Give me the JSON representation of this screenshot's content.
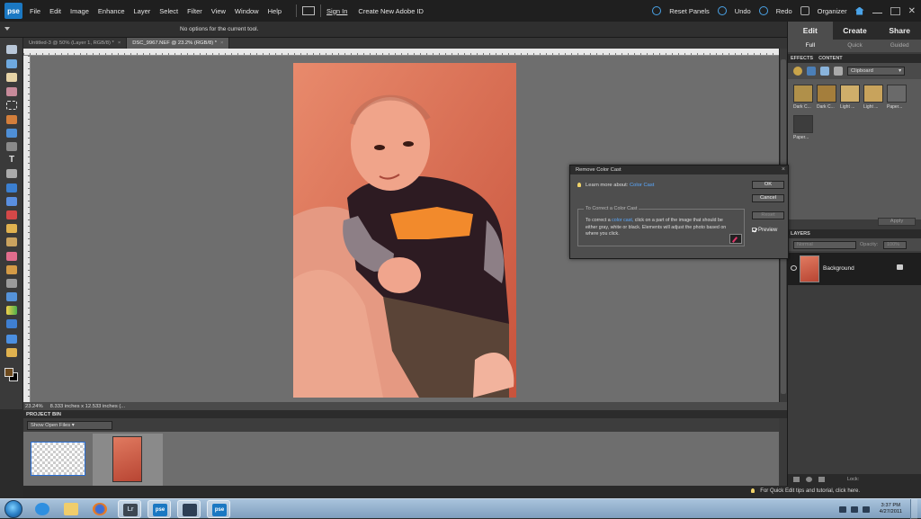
{
  "app": {
    "logo": "pse"
  },
  "menu": [
    "File",
    "Edit",
    "Image",
    "Enhance",
    "Layer",
    "Select",
    "Filter",
    "View",
    "Window",
    "Help"
  ],
  "topbar": {
    "sign_in": "Sign In",
    "create_id": "Create New Adobe ID",
    "reset_panels": "Reset Panels",
    "undo": "Undo",
    "redo": "Redo",
    "organizer": "Organizer"
  },
  "options_bar": {
    "text": "No options for the current tool."
  },
  "doc_tabs": [
    {
      "label": "Untitled-3 @ 50% (Layer 1, RGB/8) *",
      "active": false
    },
    {
      "label": "DSC_9967.NEF @ 23.2% (RGB/8) *",
      "active": true
    }
  ],
  "status": {
    "zoom": "23.24%",
    "info": "8.333 inches x 12.533 inches (..."
  },
  "project_bin": {
    "title": "PROJECT BIN",
    "dropdown": "Show Open Files"
  },
  "panel": {
    "mode_tabs": [
      "Edit",
      "Create",
      "Share"
    ],
    "sub_tabs": [
      "Full",
      "Quick",
      "Guided"
    ],
    "effects_tabs": [
      "EFFECTS",
      "CONTENT"
    ],
    "effects_dropdown": "Clipboard",
    "effects": [
      {
        "label": "Dark C...",
        "color": "#b0904a"
      },
      {
        "label": "Dark C...",
        "color": "#a47e3c"
      },
      {
        "label": "Light ...",
        "color": "#cfae6a"
      },
      {
        "label": "Light ...",
        "color": "#c8a35c"
      },
      {
        "label": "Paper...",
        "color": "#6a6a6a"
      },
      {
        "label": "Paper...",
        "color": "#3d3d3d"
      }
    ],
    "apply": "Apply",
    "layers_title": "LAYERS",
    "blend_mode": "Normal",
    "opacity_label": "Opacity:",
    "opacity_value": "100%",
    "layer_name": "Background",
    "lock_label": "Lock:"
  },
  "dialog": {
    "title": "Remove Color Cast",
    "learn_prefix": "Learn more about:",
    "learn_link": "Color Cast",
    "group_label": "To Correct a Color Cast",
    "instr_1": "To correct a",
    "instr_link": "color cast,",
    "instr_2": "click on a part of the image that should be either gray, white or black. Elements will adjust the photo based on where you click.",
    "ok": "OK",
    "cancel": "Cancel",
    "reset": "Reset",
    "preview": "Preview"
  },
  "hint": "For Quick Edit tips and tutorial, click here.",
  "taskbar": {
    "time": "3:37 PM",
    "date": "4/27/2011"
  }
}
